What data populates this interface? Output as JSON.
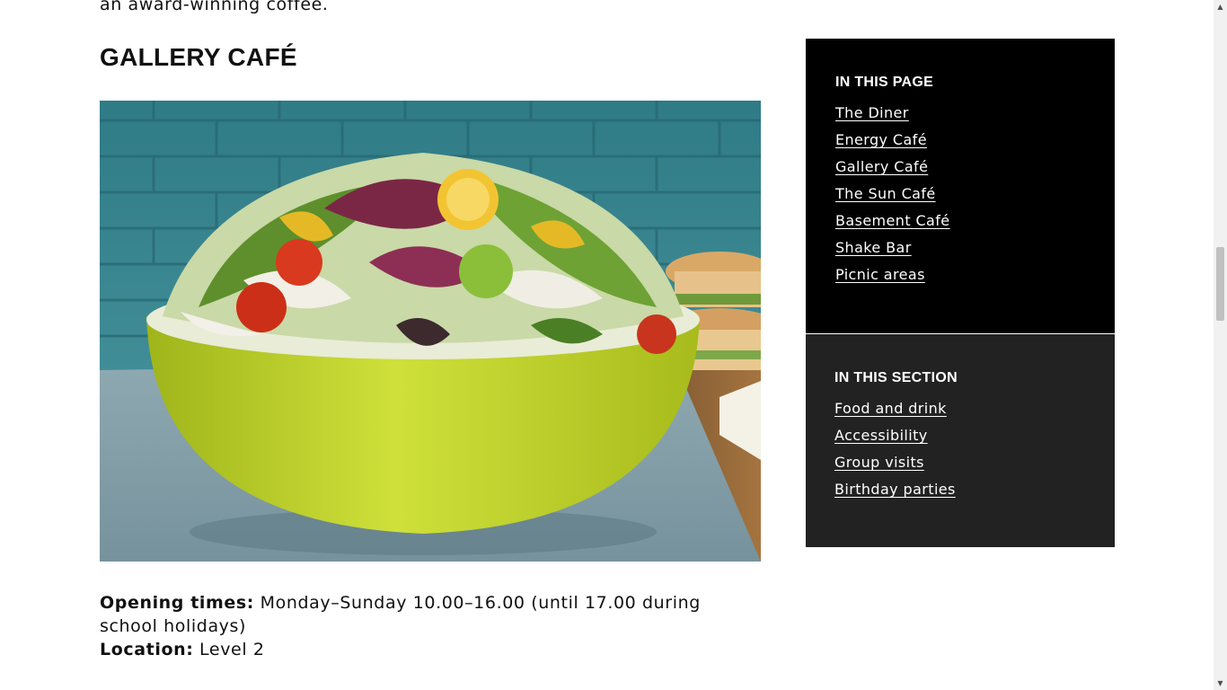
{
  "intro_text": "an award-winning coffee.",
  "section_title": "GALLERY CAFÉ",
  "photo": {
    "alt": "salad-bowl-photo"
  },
  "info": {
    "opening_label": "Opening times:",
    "opening_value": " Monday–Sunday 10.00–16.00 (until 17.00 during school holidays)",
    "location_label": "Location:",
    "location_value": " Level 2"
  },
  "in_this_page": {
    "heading": "IN THIS PAGE",
    "links": [
      "The Diner",
      "Energy Café",
      "Gallery Café",
      "The Sun Café",
      "Basement Café",
      "Shake Bar",
      "Picnic areas"
    ]
  },
  "in_this_section": {
    "heading": "IN THIS SECTION",
    "links": [
      "Food and drink",
      "Accessibility",
      "Group visits",
      "Birthday parties"
    ]
  },
  "colors": {
    "nav_page_bg": "#000000",
    "nav_section_bg": "#222222",
    "text": "#111111",
    "bowl": "#c3d52c"
  },
  "icons": {
    "scroll_up": "▲",
    "scroll_down": "▼"
  }
}
